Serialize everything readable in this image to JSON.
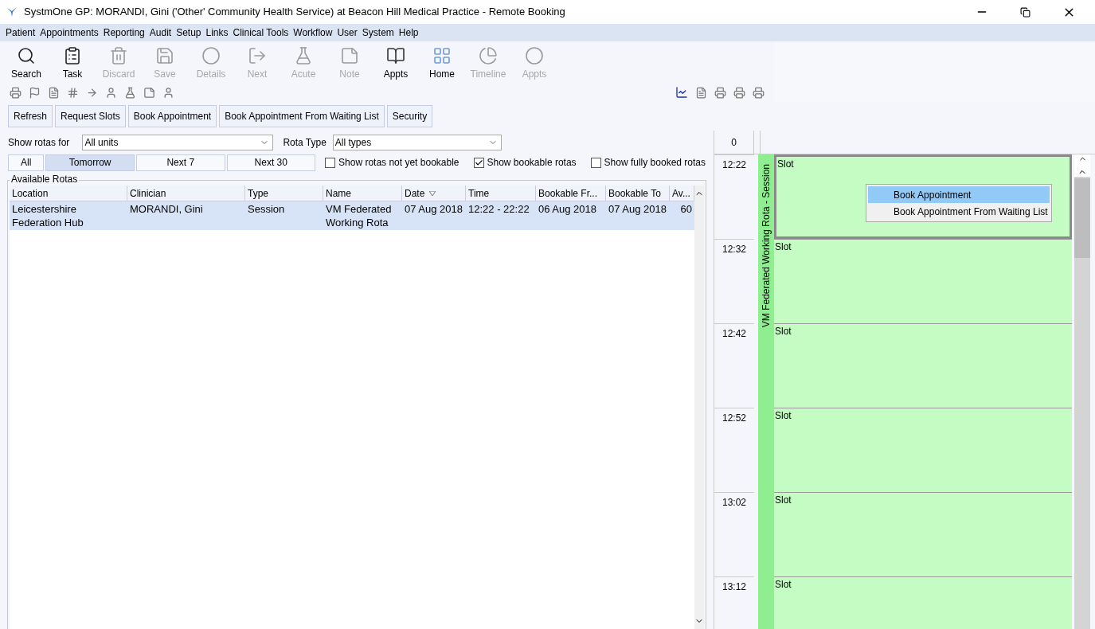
{
  "window": {
    "title": "SystmOne GP: MORANDI, Gini ('Other' Community Health Service) at Beacon Hill Medical Practice - Remote Booking"
  },
  "menu": [
    "Patient",
    "Appointments",
    "Reporting",
    "Audit",
    "Setup",
    "Links",
    "Clinical Tools",
    "Workflow",
    "User",
    "System",
    "Help"
  ],
  "toolbar": [
    {
      "label": "Search",
      "kind": "search",
      "disabled": false
    },
    {
      "label": "Task",
      "kind": "task",
      "disabled": false
    },
    {
      "label": "Discard",
      "kind": "discard",
      "disabled": true
    },
    {
      "label": "Save",
      "kind": "save",
      "disabled": true
    },
    {
      "label": "Details",
      "kind": "details",
      "disabled": true
    },
    {
      "label": "Next",
      "kind": "next",
      "disabled": true
    },
    {
      "label": "Acute",
      "kind": "acute",
      "disabled": true
    },
    {
      "label": "Note",
      "kind": "note",
      "disabled": true
    },
    {
      "label": "Appts",
      "kind": "appts",
      "disabled": false
    },
    {
      "label": "Home",
      "kind": "home",
      "disabled": false
    },
    {
      "label": "Timeline",
      "kind": "timeline",
      "disabled": true
    },
    {
      "label": "Appts",
      "kind": "appts2",
      "disabled": true
    }
  ],
  "actions": [
    "Refresh",
    "Request Slots",
    "Book Appointment",
    "Book Appointment From Waiting List",
    "Security"
  ],
  "filters": {
    "show_rotas_for_label": "Show rotas for",
    "show_rotas_for": "All units",
    "rota_type_label": "Rota Type",
    "rota_type": "All types"
  },
  "ranges": [
    {
      "label": "All",
      "selected": false
    },
    {
      "label": "Tomorrow",
      "selected": true
    },
    {
      "label": "Next 7",
      "selected": false
    },
    {
      "label": "Next 30",
      "selected": false
    }
  ],
  "checkboxes": [
    {
      "label": "Show rotas not yet bookable",
      "checked": false
    },
    {
      "label": "Show bookable rotas",
      "checked": true
    },
    {
      "label": "Show fully booked rotas",
      "checked": false
    }
  ],
  "table": {
    "title": "Available Rotas",
    "columns": [
      "Location",
      "Clinician",
      "Type",
      "Name",
      "Date",
      "Time",
      "Bookable Fr...",
      "Bookable To",
      "Av..."
    ],
    "rows": [
      {
        "selected": true,
        "cells": [
          "Leicestershire Federation Hub",
          "MORANDI, Gini",
          "Session",
          "VM Federated Working Rota",
          "07 Aug 2018",
          "12:22 - 22:22",
          "06 Aug 2018",
          "07 Aug 2018",
          "60"
        ]
      }
    ]
  },
  "schedule": {
    "header": "0",
    "rota_label": "VM Federated Working Rota - Session",
    "slots": [
      {
        "time": "12:22",
        "label": "Slot",
        "selected": true
      },
      {
        "time": "12:32",
        "label": "Slot",
        "selected": false
      },
      {
        "time": "12:42",
        "label": "Slot",
        "selected": false
      },
      {
        "time": "12:52",
        "label": "Slot",
        "selected": false
      },
      {
        "time": "13:02",
        "label": "Slot",
        "selected": false
      },
      {
        "time": "13:12",
        "label": "Slot",
        "selected": false
      }
    ]
  },
  "context_menu": [
    {
      "label": "Book Appointment",
      "selected": true
    },
    {
      "label": "Book Appointment From Waiting List",
      "selected": false
    }
  ]
}
